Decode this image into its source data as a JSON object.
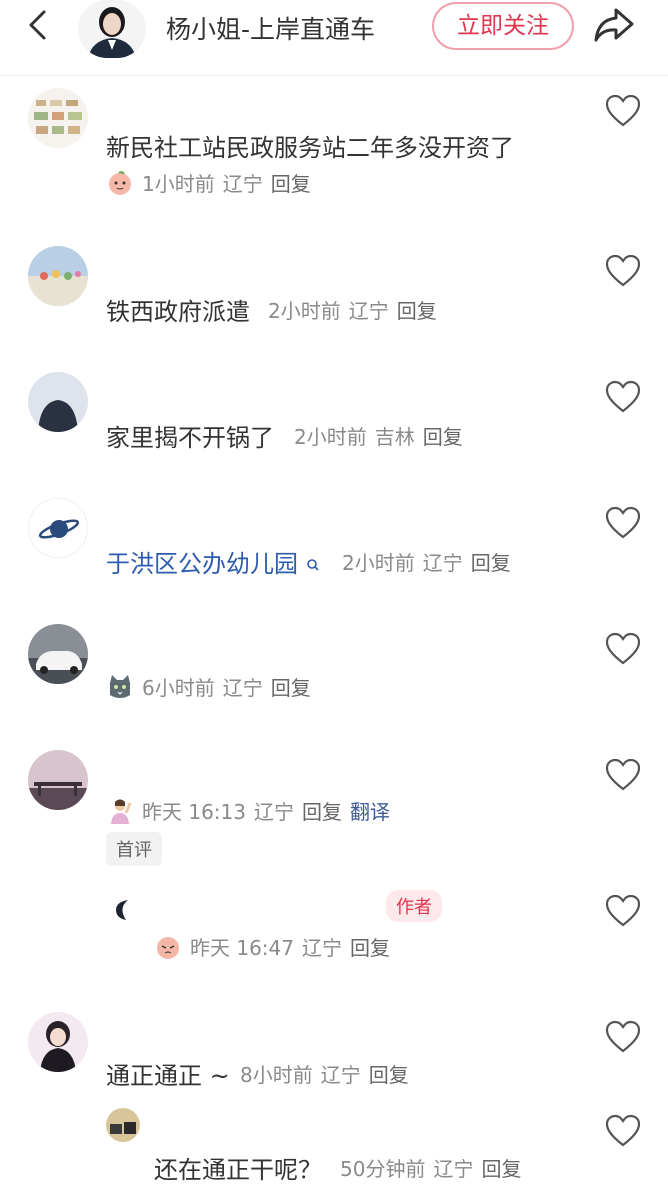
{
  "header": {
    "title": "杨小姐-上岸直通车",
    "follow_label": "立即关注"
  },
  "comments": [
    {
      "text": "新民社工站民政服务站二年多没开资了",
      "time": "1小时前",
      "region": "辽宁",
      "reply": "回复"
    },
    {
      "text": "铁西政府派遣",
      "time": "2小时前",
      "region": "辽宁",
      "reply": "回复"
    },
    {
      "text": "家里揭不开锅了",
      "time": "2小时前",
      "region": "吉林",
      "reply": "回复"
    },
    {
      "text": "于洪区公办幼儿园",
      "time": "2小时前",
      "region": "辽宁",
      "reply": "回复"
    },
    {
      "text": "",
      "time": "6小时前",
      "region": "辽宁",
      "reply": "回复"
    },
    {
      "time": "昨天 16:13",
      "region": "辽宁",
      "reply": "回复",
      "translate": "翻译",
      "tag": "首评"
    },
    {
      "time": "昨天 16:47",
      "region": "辽宁",
      "reply": "回复",
      "author_tag": "作者"
    },
    {
      "text": "通正通正 ~",
      "time": "8小时前",
      "region": "辽宁",
      "reply": "回复"
    },
    {
      "text": "还在通正干呢？",
      "time": "50分钟前",
      "region": "辽宁",
      "reply": "回复"
    }
  ],
  "colors": {
    "accent": "#e0364f",
    "link": "#2b5cae",
    "meta": "#8a8a8a"
  }
}
